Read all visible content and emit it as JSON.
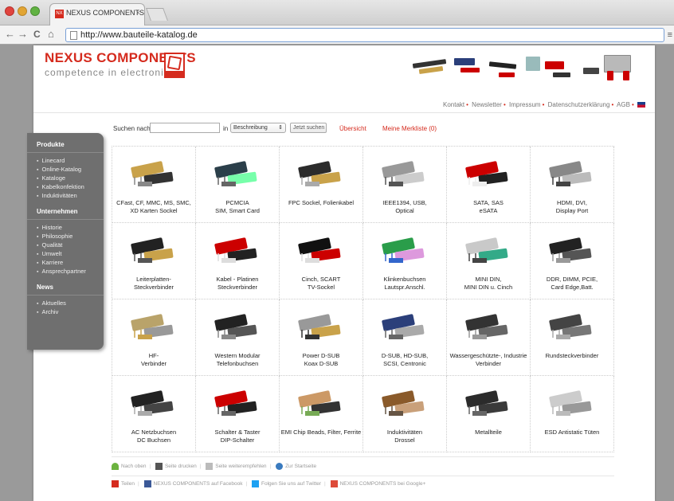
{
  "browser": {
    "tab_title": "NEXUS COMPONENTS – Onli",
    "tab_close": "×",
    "favicon_text": "NX",
    "url": "http://www.bauteile-katalog.de",
    "back": "←",
    "forward": "→",
    "reload": "C",
    "home": "⌂",
    "menu": "≡"
  },
  "header": {
    "logo_title": "NEXUS COMPONENTS",
    "logo_subtitle": "competence in electronics",
    "top_links": [
      "Kontakt",
      "Newsletter",
      "Impressum",
      "Datenschutzerklärung",
      "AGB"
    ]
  },
  "sidebar": {
    "sections": [
      {
        "title": "Produkte",
        "items": [
          "Linecard",
          "Online-Katalog",
          "Kataloge",
          "Kabelkonfektion",
          "Induktivitäten"
        ]
      },
      {
        "title": "Unternehmen",
        "items": [
          "Historie",
          "Philosophie",
          "Qualität",
          "Umwelt",
          "Karriere",
          "Ansprechpartner"
        ]
      },
      {
        "title": "News",
        "items": [
          "Aktuelles",
          "Archiv"
        ]
      }
    ]
  },
  "search": {
    "label": "Suchen nach",
    "value": "",
    "in_label": "in",
    "select_value": "Beschreibung",
    "button": "Jetzt suchen",
    "overview": "Übersicht",
    "watchlist": "Meine Merkliste (0)"
  },
  "categories": [
    "CFast, CF, MMC, MS, SMC,\nXD Karten Sockel",
    "PCMCIA\nSIM, Smart Card",
    "FPC Sockel, Folienkabel",
    "IEEE1394, USB,\nOptical",
    "SATA, SAS\neSATA",
    "HDMI, DVI,\nDisplay Port",
    "Leiterplatten-\nSteckverbinder",
    "Kabel - Platinen\nSteckverbinder",
    "Cinch, SCART\nTV-Sockel",
    "Klinkenbuchsen\nLautspr.Anschl.",
    "MINI DIN,\nMINI DIN u. Cinch",
    "DDR, DIMM, PCIE,\nCard Edge,Batt.",
    "HF-\nVerbinder",
    "Western Modular\nTelefonbuchsen",
    "Power D-SUB\nKoax D-SUB",
    "D-SUB, HD-SUB,\nSCSI, Centronic",
    "Wassergeschützte-, Industrie\nVerbinder",
    "Rundsteckverbinder",
    "AC Netzbuchsen\nDC Buchsen",
    "Schalter & Taster\nDIP-Schalter",
    "EMI Chip Beads, Filter, Ferrite",
    "Induktivitäten\nDrossel",
    "Metallteile",
    "ESD Antistatic Tüten"
  ],
  "footer": {
    "row1": [
      "Nach oben",
      "Seite drucken",
      "Seite weiterempfehlen",
      "Zur Startseite"
    ],
    "row2": [
      "Teilen",
      "NEXUS COMPONENTS auf Facebook",
      "Folgen Sie uns auf Twitter",
      "NEXUS COMPONENTS bei Google+"
    ]
  },
  "colors": {
    "brand_red": "#d52b1e",
    "sidebar_gray": "#6f6f6f"
  }
}
